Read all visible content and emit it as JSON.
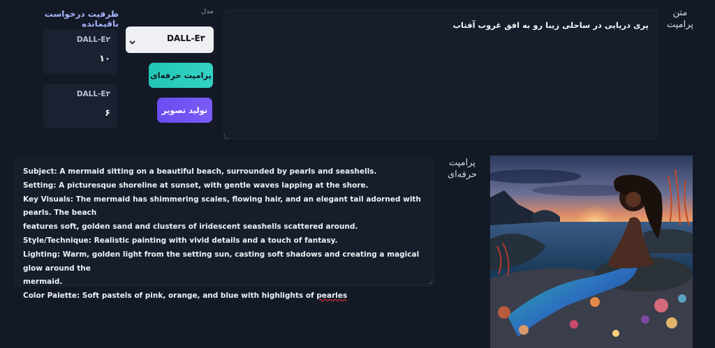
{
  "prompt": {
    "label": "متن پرامپت",
    "text": "پری دریایی در ساحلی زیبا رو به افق غروب آفتاب"
  },
  "model": {
    "label": "مدل",
    "selected": "DALL-E۳"
  },
  "buttons": {
    "pro_prompt": "پرامپت حرفه‌ای",
    "generate": "تولید تصویر"
  },
  "quota": {
    "title": "ظرفیت درخواست باقیمانده",
    "items": [
      {
        "name": "DALL-E۲",
        "count": "۱۰"
      },
      {
        "name": "DALL-E۳",
        "count": "۶"
      }
    ]
  },
  "pro_prompt": {
    "label": "پرامپت حرفه‌ای",
    "lines": [
      "Subject: A mermaid sitting on a beautiful beach, surrounded by pearls and seashells.",
      "Setting: A picturesque shoreline at sunset, with gentle waves lapping at the shore.",
      "Key Visuals: The mermaid has shimmering scales, flowing hair, and an elegant tail adorned with pearls. The beach",
      "features soft, golden sand and clusters of iridescent seashells scattered around.",
      "Style/Technique: Realistic painting with vivid details and a touch of fantasy.",
      "Lighting: Warm, golden light from the setting sun, casting soft shadows and creating a magical glow around the",
      "mermaid.",
      "Color Palette: Soft pastels of pink, orange, and blue with highlights of "
    ],
    "misspelled_word": "pearles"
  },
  "colors": {
    "background": "#131a26",
    "panel": "#161d2b",
    "accent_teal": "#22c6b4",
    "accent_purple": "#6a4df0",
    "quota_title": "#a9b4ff"
  }
}
